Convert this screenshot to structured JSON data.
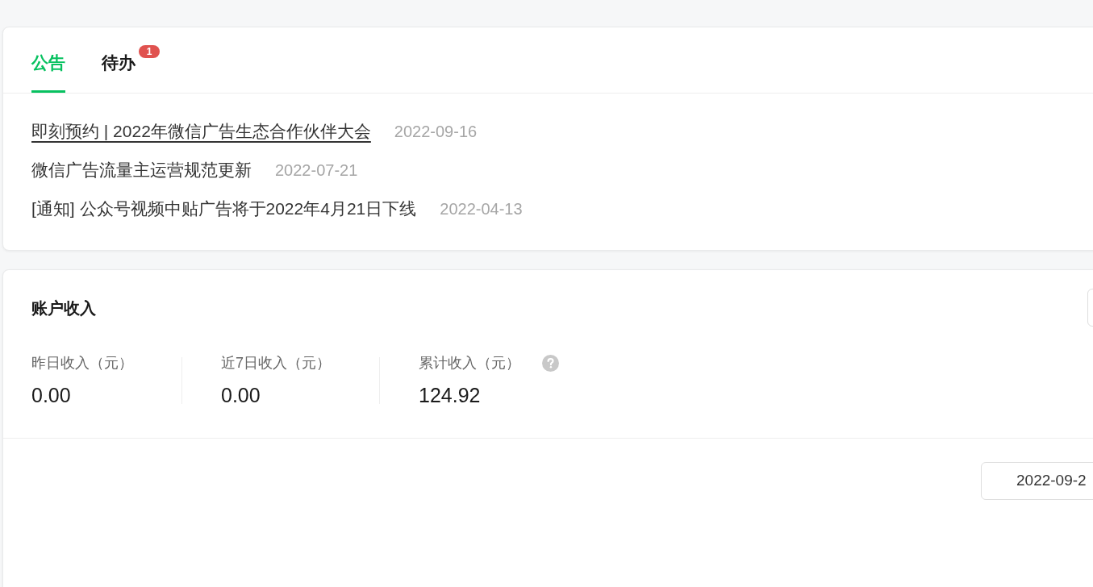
{
  "notice_card": {
    "tabs": [
      {
        "label": "公告",
        "selected": true
      },
      {
        "label": "待办",
        "selected": false,
        "badge": "1"
      }
    ],
    "notices": [
      {
        "title": "即刻预约 | 2022年微信广告生态合作伙伴大会",
        "date": "2022-09-16",
        "hovered": true
      },
      {
        "title": "微信广告流量主运营规范更新",
        "date": "2022-07-21",
        "hovered": false
      },
      {
        "title": "[通知] 公众号视频中贴广告将于2022年4月21日下线",
        "date": "2022-04-13",
        "hovered": false
      }
    ]
  },
  "income_card": {
    "title": "账户收入",
    "stats": [
      {
        "label": "昨日收入（元）",
        "value": "0.00",
        "help": false
      },
      {
        "label": "近7日收入（元）",
        "value": "0.00",
        "help": false
      },
      {
        "label": "累计收入（元）",
        "value": "124.92",
        "help": true
      }
    ],
    "date_field": {
      "value": "2022-09-2"
    }
  }
}
